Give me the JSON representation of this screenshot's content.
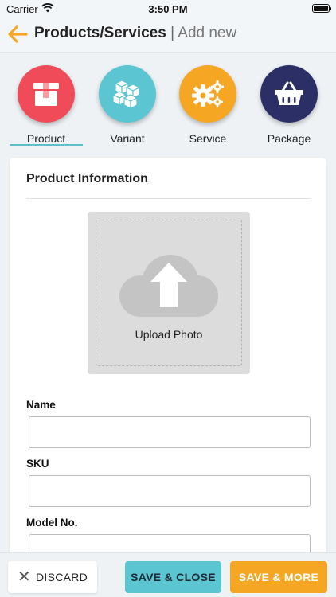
{
  "status_bar": {
    "carrier": "Carrier",
    "time": "3:50 PM"
  },
  "nav": {
    "title": "Products/Services",
    "separator": " | ",
    "subtitle": "Add new",
    "back_icon": "arrow-left-icon",
    "back_color": "#f5a623"
  },
  "type_tabs": [
    {
      "label": "Product",
      "icon": "box-icon",
      "color": "#ef4b58",
      "selected": true
    },
    {
      "label": "Variant",
      "icon": "cubes-icon",
      "color": "#5bc5d2",
      "selected": false
    },
    {
      "label": "Service",
      "icon": "gears-icon",
      "color": "#f5a623",
      "selected": false
    },
    {
      "label": "Package",
      "icon": "basket-icon",
      "color": "#2c2f66",
      "selected": false
    }
  ],
  "form": {
    "section_title": "Product Information",
    "upload_label": "Upload Photo",
    "fields": [
      {
        "label": "Name",
        "value": "",
        "placeholder": ""
      },
      {
        "label": "SKU",
        "value": "",
        "placeholder": ""
      },
      {
        "label": "Model No.",
        "value": "",
        "placeholder": ""
      }
    ]
  },
  "actions": {
    "discard": "DISCARD",
    "save_close": "SAVE & CLOSE",
    "save_more": "SAVE & MORE"
  }
}
